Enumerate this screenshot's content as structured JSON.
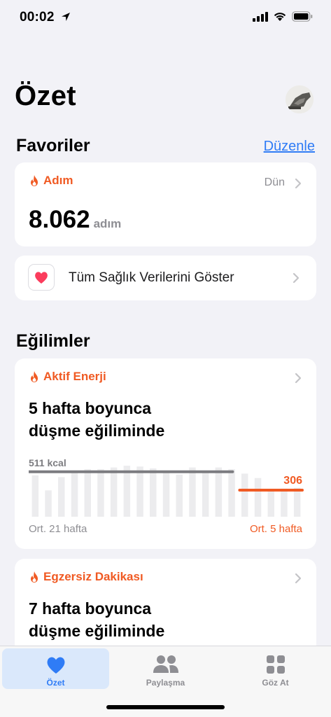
{
  "status_bar": {
    "time": "00:02"
  },
  "header": {
    "title": "Özet"
  },
  "favorites": {
    "title": "Favoriler",
    "edit_label": "Düzenle",
    "steps_card": {
      "title": "Adım",
      "date": "Dün",
      "value": "8.062",
      "unit": "adım"
    },
    "all_data_label": "Tüm Sağlık Verilerini Göster"
  },
  "trends": {
    "title": "Eğilimler",
    "cards": [
      {
        "title": "Aktif Enerji",
        "summary_line1": "5 hafta boyunca",
        "summary_line2": "düşme eğiliminde",
        "chart": {
          "long_avg_label": "511 kcal",
          "short_avg_label": "306",
          "left_caption": "Ort. 21 hafta",
          "right_caption": "Ort. 5 hafta"
        }
      },
      {
        "title": "Egzersiz Dakikası",
        "summary_line1": "7 hafta boyunca",
        "summary_line2": "düşme eğiliminde"
      }
    ]
  },
  "tab_bar": {
    "tabs": [
      {
        "label": "Özet",
        "icon": "heart-icon"
      },
      {
        "label": "Paylaşma",
        "icon": "people-icon"
      },
      {
        "label": "Göz At",
        "icon": "grid-icon"
      }
    ]
  },
  "chart_data": {
    "type": "bar",
    "categories": [
      "1",
      "2",
      "3",
      "4",
      "5",
      "6",
      "7",
      "8",
      "9",
      "10",
      "11",
      "12",
      "13",
      "14",
      "15",
      "16",
      "17",
      "18",
      "19",
      "20",
      "21"
    ],
    "values": [
      470,
      300,
      450,
      520,
      540,
      540,
      560,
      580,
      570,
      550,
      510,
      480,
      560,
      520,
      560,
      540,
      490,
      440,
      300,
      320,
      330
    ],
    "reference_lines": [
      {
        "label": "511 kcal",
        "value": 511,
        "span": "weeks 1-16"
      },
      {
        "label": "306",
        "value": 306,
        "span": "weeks 17-21"
      }
    ],
    "ylim": [
      0,
      700
    ],
    "colors": {
      "bars": "#ececee",
      "long_avg": "#7c7c80",
      "short_avg": "#f05a23"
    }
  }
}
